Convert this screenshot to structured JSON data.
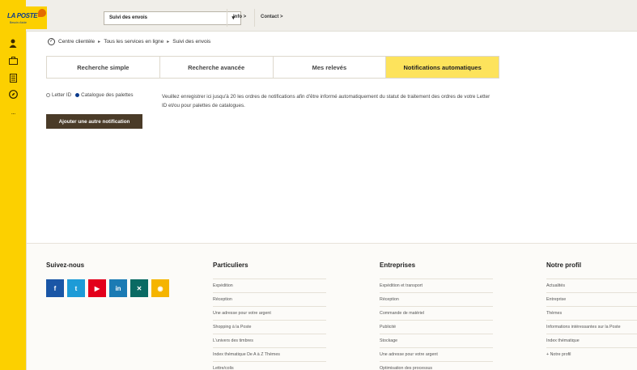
{
  "logo": {
    "text": "LA POSTE",
    "sub": "Besoin d'aide"
  },
  "sidebar": {
    "icons": [
      {
        "name": "user-icon",
        "glyph": "👤"
      },
      {
        "name": "briefcase-icon",
        "glyph": "⊡"
      },
      {
        "name": "building-icon",
        "glyph": "▤"
      },
      {
        "name": "compass-icon",
        "glyph": "◎"
      },
      {
        "name": "more-icon",
        "glyph": "···"
      }
    ]
  },
  "header": {
    "service_select": "Suivi des envois",
    "links": [
      "Info >",
      "Contact >"
    ]
  },
  "breadcrumb": [
    "Centre clientèle",
    "Tous les services en ligne",
    "Suivi des envois"
  ],
  "tabs": [
    "Recherche simple",
    "Recherche avancée",
    "Mes relevés",
    "Notifications automatiques"
  ],
  "options": {
    "letter_id": "Letter ID",
    "catalogue": "Catalogue des palettes"
  },
  "description": "Veuillez enregistrer ici jusqu'à 20 les ordres de notifications afin d'être informé automatiquement du statut de traitement des ordres de votre Letter ID et/ou pour palettes de catalogues.",
  "add_button": "Ajouter une autre notification",
  "footer": {
    "follow": "Suivez-nous",
    "socials": [
      {
        "name": "facebook",
        "label": "f",
        "color": "#1a56a6"
      },
      {
        "name": "twitter",
        "label": "t",
        "color": "#1d9bd7"
      },
      {
        "name": "youtube",
        "label": "▶",
        "color": "#e3001b"
      },
      {
        "name": "linkedin",
        "label": "in",
        "color": "#1b7bb4"
      },
      {
        "name": "xing",
        "label": "✕",
        "color": "#0a6a63"
      },
      {
        "name": "rss",
        "label": "◉",
        "color": "#f5b400"
      }
    ],
    "columns": [
      {
        "title": "Particuliers",
        "items": [
          "Expédition",
          "Réception",
          "Une adresse pour votre argent",
          "Shopping à la Poste",
          "L'univers des timbres",
          "Index thématique De A à Z Thèmes",
          "Lettre/colis"
        ]
      },
      {
        "title": "Entreprises",
        "items": [
          "Expédition et transport",
          "Réception",
          "Commande de matériel",
          "Publicité",
          "Stockage",
          "Une adresse pour votre argent",
          "Optimisation des processus"
        ]
      },
      {
        "title": "Notre profil",
        "items": [
          "Actualités",
          "Entreprise",
          "Thèmes",
          "Informations intéressantes sur la Poste",
          "Index thématique",
          "+ Notre profil"
        ]
      }
    ]
  }
}
